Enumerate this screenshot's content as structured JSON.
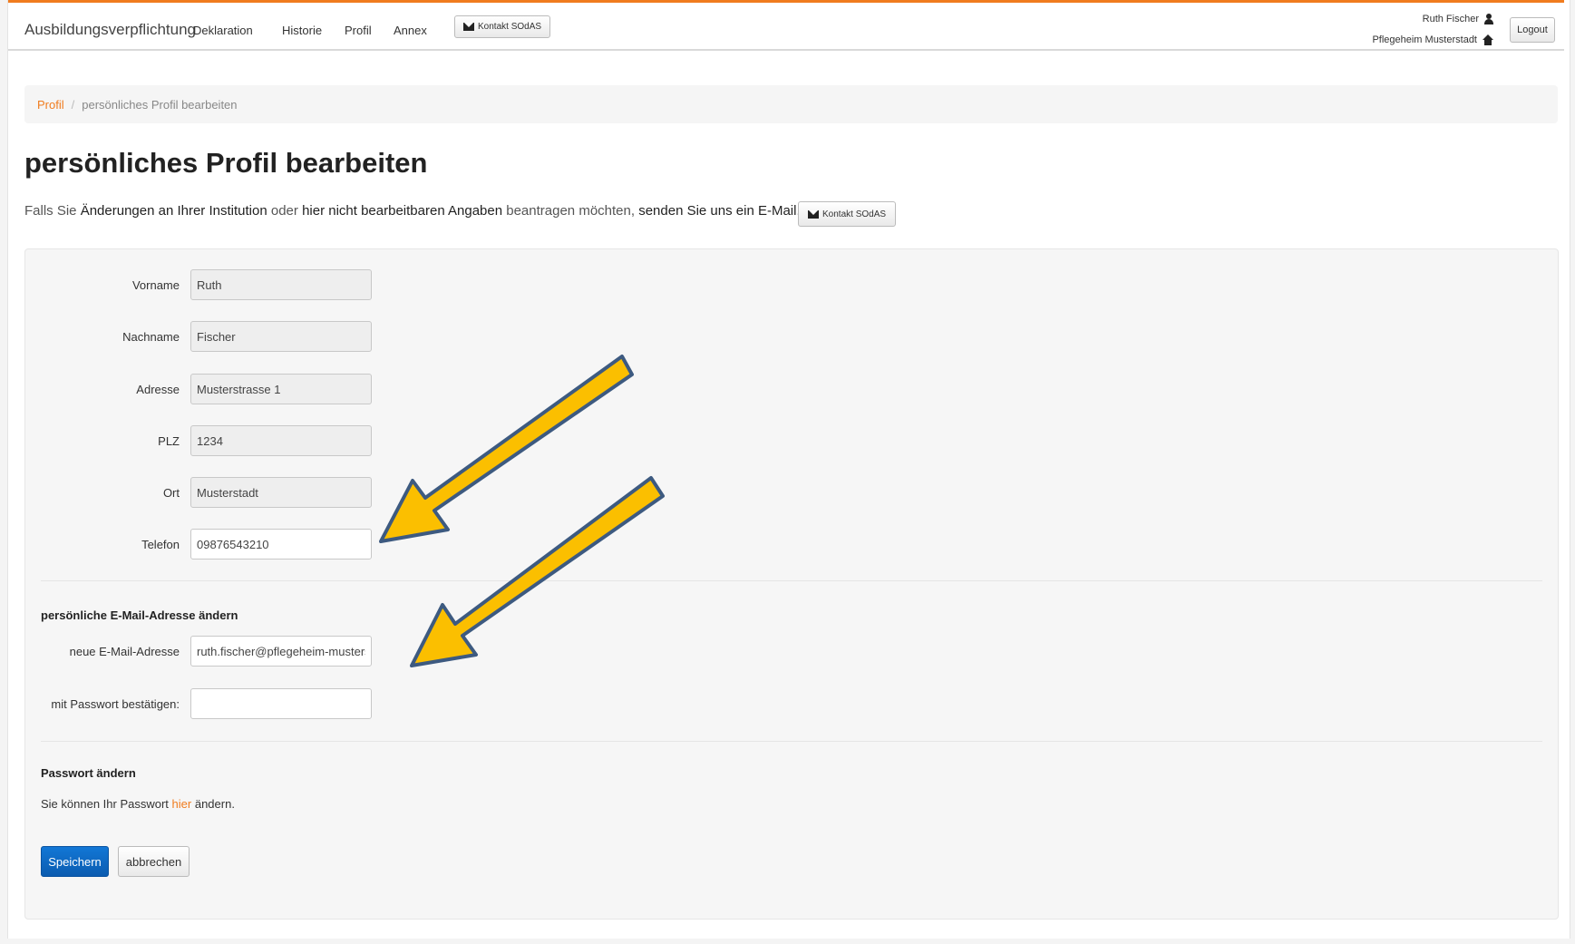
{
  "navbar": {
    "brand": "Ausbildungsverpflichtung",
    "items": [
      {
        "label": "Deklaration"
      },
      {
        "label": "Historie"
      },
      {
        "label": "Profil"
      },
      {
        "label": "Annex"
      }
    ],
    "contact_label": "Kontakt SOdAS",
    "user_name": "Ruth Fischer",
    "institution": "Pflegeheim Musterstadt",
    "logout_label": "Logout"
  },
  "breadcrumb": {
    "root": "Profil",
    "separator": "/",
    "current": "persönliches Profil bearbeiten"
  },
  "page": {
    "title": "persönliches Profil bearbeiten",
    "intro": {
      "part1": "Falls Sie",
      "part2": "Änderungen an Ihrer Institution",
      "part3": "oder",
      "part4": "hier nicht bearbeitbaren Angaben",
      "part5": "beantragen möchten,",
      "part6": "senden Sie uns ein E-Mail.",
      "contact_label": "Kontakt SOdAS"
    }
  },
  "form": {
    "fields": [
      {
        "label": "Vorname",
        "value": "Ruth",
        "editable": false
      },
      {
        "label": "Nachname",
        "value": "Fischer",
        "editable": false
      },
      {
        "label": "Adresse",
        "value": "Musterstrasse 1",
        "editable": false
      },
      {
        "label": "PLZ",
        "value": "1234",
        "editable": false
      },
      {
        "label": "Ort",
        "value": "Musterstadt",
        "editable": false
      },
      {
        "label": "Telefon",
        "value": "09876543210",
        "editable": true
      }
    ],
    "email_section": {
      "title": "persönliche E-Mail-Adresse ändern",
      "email_label": "neue E-Mail-Adresse",
      "email_value": "ruth.fischer@pflegeheim-musterstadt",
      "password_label": "mit Passwort bestätigen:",
      "password_value": ""
    },
    "password_section": {
      "title": "Passwort ändern",
      "text_before": "Sie können Ihr Passwort",
      "link": "hier",
      "text_after": "ändern."
    },
    "save_label": "Speichern",
    "cancel_label": "abbrechen"
  },
  "colors": {
    "accent": "#f07c1e",
    "primary_button": "#0b5cb0",
    "annotation_arrow": "#fbbf00",
    "annotation_outline": "#3d5a80"
  },
  "icons": {
    "mail": "envelope-icon",
    "user": "user-icon",
    "home": "home-icon"
  }
}
